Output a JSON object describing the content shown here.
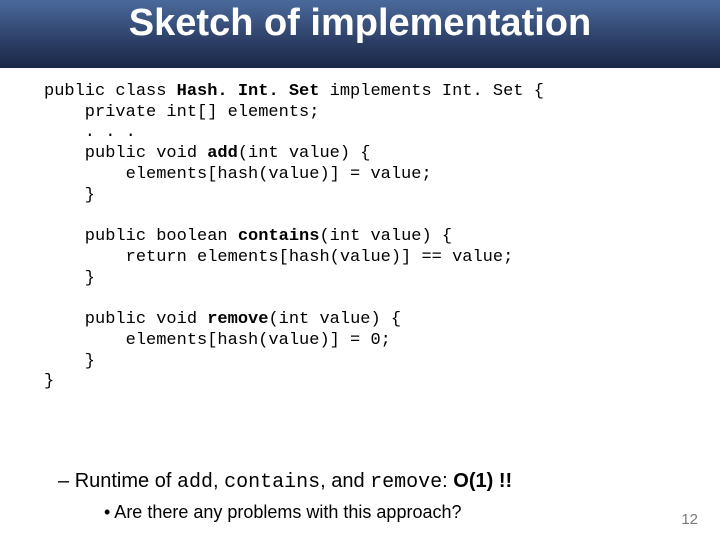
{
  "title": "Sketch of implementation",
  "code": {
    "l1a": "public class ",
    "l1b": "Hash. Int. Set",
    "l1c": " implements Int. Set {",
    "l2": "    private int[] elements;",
    "l3": "    . . .",
    "l4a": "    public void ",
    "l4b": "add",
    "l4c": "(int value) {",
    "l5": "        elements[hash(value)] = value;",
    "l6": "    }",
    "blank1": " ",
    "l7a": "    public boolean ",
    "l7b": "contains",
    "l7c": "(int value) {",
    "l8": "        return elements[hash(value)] == value;",
    "l9": "    }",
    "blank2": " ",
    "l10a": "    public void ",
    "l10b": "remove",
    "l10c": "(int value) {",
    "l11": "        elements[hash(value)] = 0;",
    "l12": "    }",
    "l13": "}"
  },
  "note": {
    "dash": "– ",
    "t1": "Runtime of ",
    "m1": "add",
    "t2": ", ",
    "m2": "contains",
    "t3": ", and ",
    "m3": "remove",
    "t4": ": ",
    "big": "O(1) !!"
  },
  "subnote": "• Are there any problems with this approach?",
  "pagenum": "12"
}
